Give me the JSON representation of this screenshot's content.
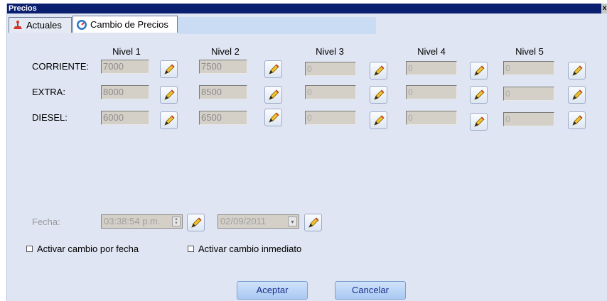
{
  "window": {
    "title": "Precios",
    "close_label": "x"
  },
  "tabs": [
    {
      "label": "Actuales",
      "icon": "scale-icon"
    },
    {
      "label": "Cambio de Precios",
      "icon": "gauge-icon"
    }
  ],
  "levels": [
    "Nivel 1",
    "Nivel 2",
    "Nivel 3",
    "Nivel 4",
    "Nivel 5"
  ],
  "rows": [
    {
      "label": "CORRIENTE:",
      "values": [
        "7000",
        "7500",
        "0",
        "0",
        "0"
      ]
    },
    {
      "label": "EXTRA:",
      "values": [
        "8000",
        "8500",
        "0",
        "0",
        "0"
      ]
    },
    {
      "label": "DIESEL:",
      "values": [
        "6000",
        "6500",
        "0",
        "0",
        "0"
      ]
    }
  ],
  "fecha": {
    "label": "Fecha:",
    "time": "03:38:54 p.m.",
    "date": "02/09/2011"
  },
  "checkboxes": {
    "by_date": {
      "label": "Activar cambio por fecha",
      "checked": false
    },
    "immediate": {
      "label": "Activar cambio inmediato",
      "checked": false
    }
  },
  "buttons": {
    "accept": "Aceptar",
    "cancel": "Cancelar"
  },
  "colors": {
    "titlebar": "#0b1f70",
    "panel": "#dfe5f2",
    "button_text": "#1a2d8a"
  }
}
